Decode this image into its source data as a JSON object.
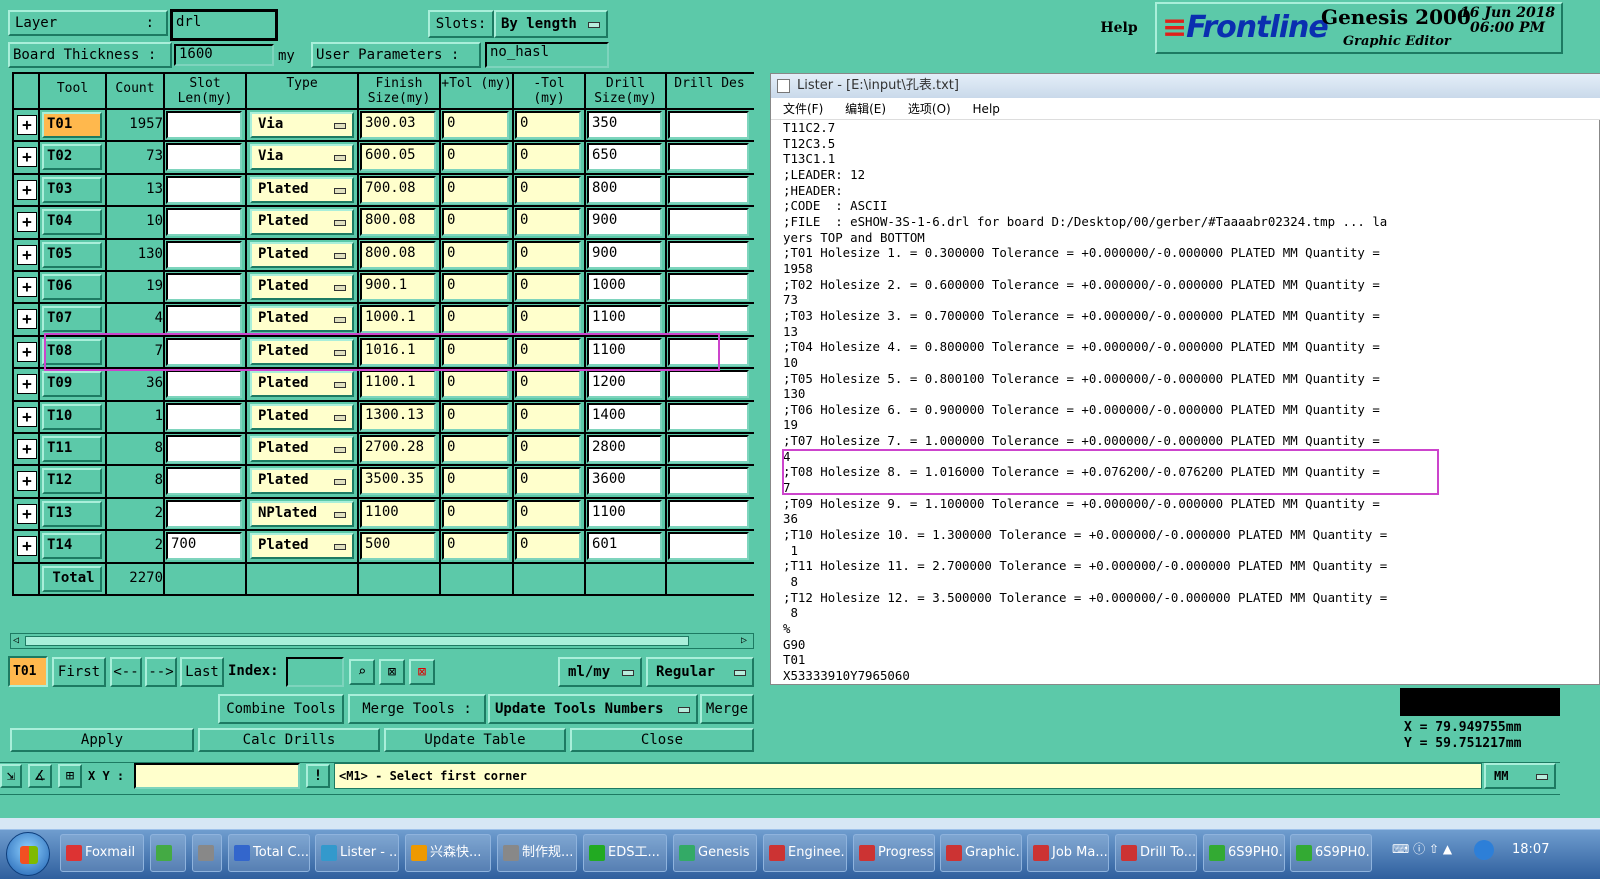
{
  "header": {
    "help_label": "Help",
    "brand": "Frontline",
    "product": "Genesis 2000",
    "subtitle": "Graphic Editor",
    "date": "16 Jun 2018",
    "time": "06:00 PM"
  },
  "drill_tools": {
    "layer_label": "Layer",
    "layer_value": "drl",
    "slots_label": "Slots:",
    "slots_value": "By length",
    "board_thickness_label": "Board Thickness :",
    "board_thickness_value": "1600",
    "board_thickness_unit": "my",
    "user_params_label": "User Parameters :",
    "user_params_value": "no_hasl",
    "columns": [
      "Tool",
      "Count",
      "Slot Len(my)",
      "Type",
      "Finish Size(my)",
      "+Tol (my)",
      "-Tol (my)",
      "Drill Size(my)",
      "Drill Des"
    ],
    "rows": [
      {
        "tool": "T01",
        "count": "1957",
        "slot": "",
        "type": "Via",
        "finish": "300.03",
        "ptol": "0",
        "mtol": "0",
        "drill": "350"
      },
      {
        "tool": "T02",
        "count": "73",
        "slot": "",
        "type": "Via",
        "finish": "600.05",
        "ptol": "0",
        "mtol": "0",
        "drill": "650"
      },
      {
        "tool": "T03",
        "count": "13",
        "slot": "",
        "type": "Plated",
        "finish": "700.08",
        "ptol": "0",
        "mtol": "0",
        "drill": "800"
      },
      {
        "tool": "T04",
        "count": "10",
        "slot": "",
        "type": "Plated",
        "finish": "800.08",
        "ptol": "0",
        "mtol": "0",
        "drill": "900"
      },
      {
        "tool": "T05",
        "count": "130",
        "slot": "",
        "type": "Plated",
        "finish": "800.08",
        "ptol": "0",
        "mtol": "0",
        "drill": "900"
      },
      {
        "tool": "T06",
        "count": "19",
        "slot": "",
        "type": "Plated",
        "finish": "900.1",
        "ptol": "0",
        "mtol": "0",
        "drill": "1000"
      },
      {
        "tool": "T07",
        "count": "4",
        "slot": "",
        "type": "Plated",
        "finish": "1000.1",
        "ptol": "0",
        "mtol": "0",
        "drill": "1100"
      },
      {
        "tool": "T08",
        "count": "7",
        "slot": "",
        "type": "Plated",
        "finish": "1016.1",
        "ptol": "0",
        "mtol": "0",
        "drill": "1100"
      },
      {
        "tool": "T09",
        "count": "36",
        "slot": "",
        "type": "Plated",
        "finish": "1100.1",
        "ptol": "0",
        "mtol": "0",
        "drill": "1200"
      },
      {
        "tool": "T10",
        "count": "1",
        "slot": "",
        "type": "Plated",
        "finish": "1300.13",
        "ptol": "0",
        "mtol": "0",
        "drill": "1400"
      },
      {
        "tool": "T11",
        "count": "8",
        "slot": "",
        "type": "Plated",
        "finish": "2700.28",
        "ptol": "0",
        "mtol": "0",
        "drill": "2800"
      },
      {
        "tool": "T12",
        "count": "8",
        "slot": "",
        "type": "Plated",
        "finish": "3500.35",
        "ptol": "0",
        "mtol": "0",
        "drill": "3600"
      },
      {
        "tool": "T13",
        "count": "2",
        "slot": "",
        "type": "NPlated",
        "finish": "1100",
        "ptol": "0",
        "mtol": "0",
        "drill": "1100"
      },
      {
        "tool": "T14",
        "count": "2",
        "slot": "700",
        "type": "Plated",
        "finish": "500",
        "ptol": "0",
        "mtol": "0",
        "drill": "601"
      }
    ],
    "total_label": "Total",
    "total_count": "2270",
    "nav": {
      "current_tool": "T01",
      "first": "First",
      "prev": "<--",
      "next": "-->",
      "last": "Last",
      "index_label": "Index:",
      "units": "ml/my",
      "mode": "Regular"
    },
    "actions": {
      "combine": "Combine Tools",
      "merge_tools_label": "Merge Tools :",
      "update_numbers": "Update Tools Numbers",
      "merge": "Merge",
      "apply": "Apply",
      "calc": "Calc Drills",
      "update_table": "Update Table",
      "close": "Close"
    },
    "highlight_color": "#cc44cc",
    "accent_color": "#5cc9a9",
    "selected_tool_color": "#ffb84d"
  },
  "lister": {
    "title": "Lister - [E:\\input\\孔表.txt]",
    "menu": [
      "文件(F)",
      "编辑(E)",
      "选项(O)",
      "Help"
    ],
    "lines": [
      "T11C2.7",
      "T12C3.5",
      "T13C1.1",
      ";LEADER: 12",
      ";HEADER:",
      ";CODE  : ASCII",
      ";FILE  : eSHOW-3S-1-6.drl for board D:/Desktop/00/gerber/#Taaaabr02324.tmp ... la",
      "yers TOP and BOTTOM",
      ";T01 Holesize 1. = 0.300000 Tolerance = +0.000000/-0.000000 PLATED MM Quantity =",
      "1958",
      ";T02 Holesize 2. = 0.600000 Tolerance = +0.000000/-0.000000 PLATED MM Quantity =",
      "73",
      ";T03 Holesize 3. = 0.700000 Tolerance = +0.000000/-0.000000 PLATED MM Quantity =",
      "13",
      ";T04 Holesize 4. = 0.800000 Tolerance = +0.000000/-0.000000 PLATED MM Quantity =",
      "10",
      ";T05 Holesize 5. = 0.800100 Tolerance = +0.000000/-0.000000 PLATED MM Quantity =",
      "130",
      ";T06 Holesize 6. = 0.900000 Tolerance = +0.000000/-0.000000 PLATED MM Quantity =",
      "19",
      ";T07 Holesize 7. = 1.000000 Tolerance = +0.000000/-0.000000 PLATED MM Quantity =",
      "4",
      ";T08 Holesize 8. = 1.016000 Tolerance = +0.076200/-0.076200 PLATED MM Quantity =",
      "7",
      ";T09 Holesize 9. = 1.100000 Tolerance = +0.000000/-0.000000 PLATED MM Quantity =",
      "36",
      ";T10 Holesize 10. = 1.300000 Tolerance = +0.000000/-0.000000 PLATED MM Quantity =",
      " 1",
      ";T11 Holesize 11. = 2.700000 Tolerance = +0.000000/-0.000000 PLATED MM Quantity =",
      " 8",
      ";T12 Holesize 12. = 3.500000 Tolerance = +0.000000/-0.000000 PLATED MM Quantity =",
      " 8",
      "%",
      "G90",
      "T01",
      "X53333910Y7965060"
    ]
  },
  "coords": {
    "x": "X = 79.949755mm",
    "y": "Y = 59.751217mm"
  },
  "status": {
    "xy_label": "X Y :",
    "message": "<M1> - Select first corner",
    "units": "MM"
  },
  "taskbar": {
    "items": [
      "Foxmail",
      "",
      "",
      "Total C...",
      "Lister - ...",
      "兴森快...",
      "制作规...",
      "EDS工...",
      "Genesis",
      "Enginee...",
      "Progress",
      "Graphic...",
      "Job Ma...",
      "Drill To...",
      "6S9PH0...",
      "6S9PH0..."
    ],
    "clock": "18:07"
  }
}
